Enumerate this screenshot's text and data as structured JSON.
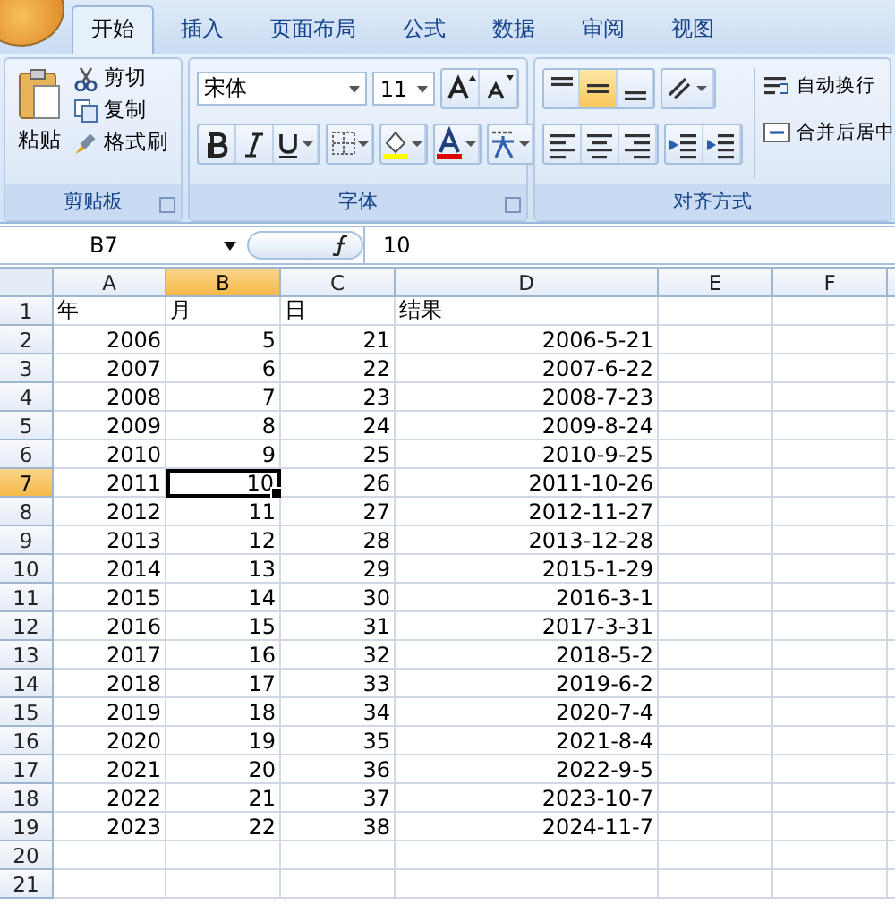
{
  "tabs": [
    {
      "label": "开始",
      "selected": true
    },
    {
      "label": "插入",
      "selected": false
    },
    {
      "label": "页面布局",
      "selected": false
    },
    {
      "label": "公式",
      "selected": false
    },
    {
      "label": "数据",
      "selected": false
    },
    {
      "label": "审阅",
      "selected": false
    },
    {
      "label": "视图",
      "selected": false
    }
  ],
  "clipboard": {
    "title": "剪贴板",
    "paste": "粘贴",
    "cut": "剪切",
    "copy": "复制",
    "format_painter": "格式刷"
  },
  "font": {
    "title": "字体",
    "font_name": "宋体",
    "font_size": "11"
  },
  "alignment": {
    "title": "对齐方式",
    "vertical": [
      {
        "selected": false
      },
      {
        "selected": true
      },
      {
        "selected": false
      }
    ],
    "wrap_text": "自动换行",
    "merge": "合并后居中"
  },
  "formula_bar": {
    "name_box": "B7",
    "formula": "10"
  },
  "columns": [
    {
      "label": "A",
      "selected": false
    },
    {
      "label": "B",
      "selected": true
    },
    {
      "label": "C",
      "selected": false
    },
    {
      "label": "D",
      "selected": false
    },
    {
      "label": "E",
      "selected": false
    },
    {
      "label": "F",
      "selected": false
    }
  ],
  "rows": [
    {
      "number": "1",
      "selected": false,
      "kind": "header",
      "cells": [
        "年",
        "月",
        "日",
        "结果"
      ]
    },
    {
      "number": "2",
      "selected": false,
      "kind": "data",
      "cells": [
        "2006",
        "5",
        "21",
        "2006-5-21"
      ]
    },
    {
      "number": "3",
      "selected": false,
      "kind": "data",
      "cells": [
        "2007",
        "6",
        "22",
        "2007-6-22"
      ]
    },
    {
      "number": "4",
      "selected": false,
      "kind": "data",
      "cells": [
        "2008",
        "7",
        "23",
        "2008-7-23"
      ]
    },
    {
      "number": "5",
      "selected": false,
      "kind": "data",
      "cells": [
        "2009",
        "8",
        "24",
        "2009-8-24"
      ]
    },
    {
      "number": "6",
      "selected": false,
      "kind": "data",
      "cells": [
        "2010",
        "9",
        "25",
        "2010-9-25"
      ]
    },
    {
      "number": "7",
      "selected": true,
      "kind": "data",
      "cells": [
        "2011",
        "10",
        "26",
        "2011-10-26"
      ]
    },
    {
      "number": "8",
      "selected": false,
      "kind": "data",
      "cells": [
        "2012",
        "11",
        "27",
        "2012-11-27"
      ]
    },
    {
      "number": "9",
      "selected": false,
      "kind": "data",
      "cells": [
        "2013",
        "12",
        "28",
        "2013-12-28"
      ]
    },
    {
      "number": "10",
      "selected": false,
      "kind": "data",
      "cells": [
        "2014",
        "13",
        "29",
        "2015-1-29"
      ]
    },
    {
      "number": "11",
      "selected": false,
      "kind": "data",
      "cells": [
        "2015",
        "14",
        "30",
        "2016-3-1"
      ]
    },
    {
      "number": "12",
      "selected": false,
      "kind": "data",
      "cells": [
        "2016",
        "15",
        "31",
        "2017-3-31"
      ]
    },
    {
      "number": "13",
      "selected": false,
      "kind": "data",
      "cells": [
        "2017",
        "16",
        "32",
        "2018-5-2"
      ]
    },
    {
      "number": "14",
      "selected": false,
      "kind": "data",
      "cells": [
        "2018",
        "17",
        "33",
        "2019-6-2"
      ]
    },
    {
      "number": "15",
      "selected": false,
      "kind": "data",
      "cells": [
        "2019",
        "18",
        "34",
        "2020-7-4"
      ]
    },
    {
      "number": "16",
      "selected": false,
      "kind": "data",
      "cells": [
        "2020",
        "19",
        "35",
        "2021-8-4"
      ]
    },
    {
      "number": "17",
      "selected": false,
      "kind": "data",
      "cells": [
        "2021",
        "20",
        "36",
        "2022-9-5"
      ]
    },
    {
      "number": "18",
      "selected": false,
      "kind": "data",
      "cells": [
        "2022",
        "21",
        "37",
        "2023-10-7"
      ]
    },
    {
      "number": "19",
      "selected": false,
      "kind": "data",
      "cells": [
        "2023",
        "22",
        "38",
        "2024-11-7"
      ]
    },
    {
      "number": "20",
      "selected": false,
      "kind": "data"
    },
    {
      "number": "21",
      "selected": false,
      "kind": "data"
    }
  ]
}
